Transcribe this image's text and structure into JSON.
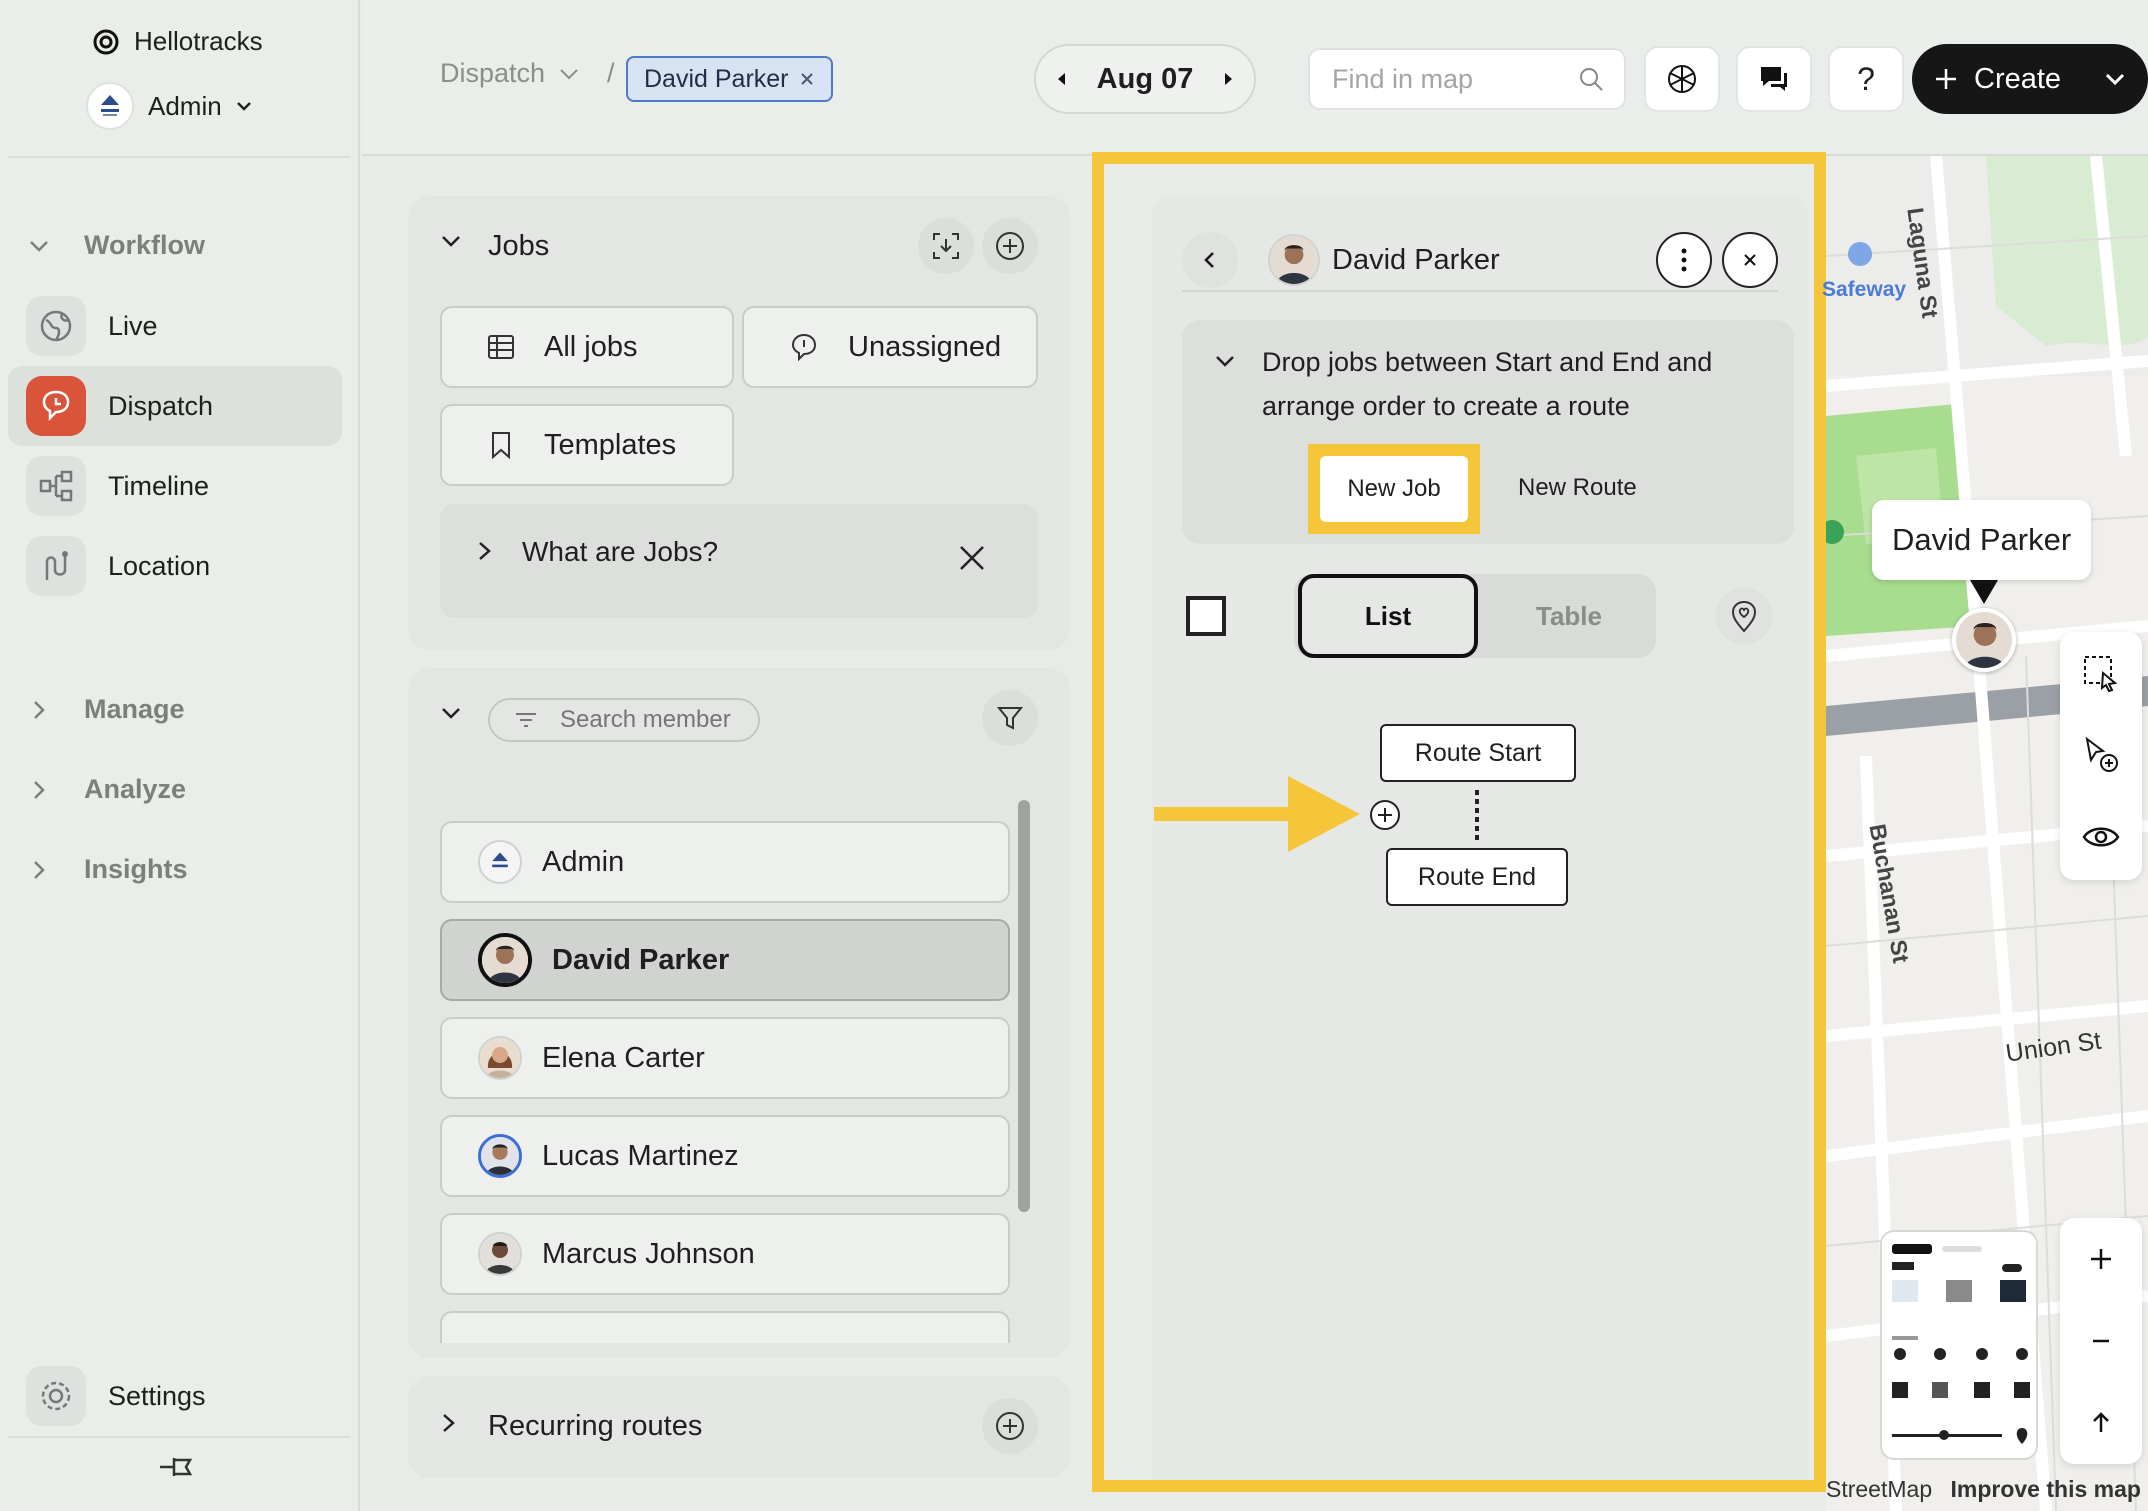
{
  "sidebar": {
    "brand": "Hellotracks",
    "account": "Admin",
    "sections": {
      "workflow": "Workflow",
      "manage": "Manage",
      "analyze": "Analyze",
      "insights": "Insights"
    },
    "items": [
      {
        "label": "Live",
        "icon": "globe-icon"
      },
      {
        "label": "Dispatch",
        "icon": "dispatch-icon",
        "active": true
      },
      {
        "label": "Timeline",
        "icon": "timeline-icon"
      },
      {
        "label": "Location",
        "icon": "route-icon"
      }
    ],
    "settings": "Settings"
  },
  "topbar": {
    "breadcrumb": "Dispatch",
    "separator": "/",
    "filter_chip": "David Parker",
    "date": "Aug 07",
    "search_placeholder": "Find in map",
    "help": "?",
    "create": "Create"
  },
  "jobs_panel": {
    "title": "Jobs",
    "all_jobs": "All jobs",
    "unassigned": "Unassigned",
    "templates": "Templates",
    "info": "What are Jobs?"
  },
  "members_panel": {
    "search_placeholder": "Search member",
    "members": [
      "Admin",
      "David Parker",
      "Elena Carter",
      "Lucas Martinez",
      "Marcus Johnson"
    ],
    "selected": "David Parker"
  },
  "recurring": {
    "title": "Recurring routes"
  },
  "route_panel": {
    "member_name": "David Parker",
    "instructions": "Drop jobs between Start and End and arrange order to create a route",
    "new_job": "New Job",
    "new_route": "New Route",
    "view_list": "List",
    "view_table": "Table",
    "route_start": "Route Start",
    "route_end": "Route End"
  },
  "map": {
    "marker_label": "David Parker",
    "streets": [
      "Laguna St",
      "Buchanan St",
      "Union St"
    ],
    "places": [
      "Safeway"
    ],
    "attribution": "StreetMap",
    "improve": "Improve this map"
  },
  "colors": {
    "highlight": "#f5c63a",
    "dispatch_active": "#d9543b",
    "create_button": "#161616"
  }
}
